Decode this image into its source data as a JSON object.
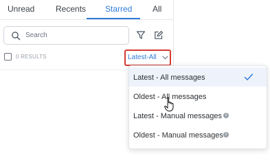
{
  "tabs": [
    {
      "label": "Unread"
    },
    {
      "label": "Recents"
    },
    {
      "label": "Starred"
    },
    {
      "label": "All"
    }
  ],
  "active_tab": "Starred",
  "search": {
    "placeholder": "Search"
  },
  "results": {
    "label": "0 RESULTS",
    "checked": false
  },
  "sort_select": {
    "value": "Latest-All"
  },
  "sort_menu": {
    "items": [
      {
        "label": "Latest - All messages",
        "selected": true
      },
      {
        "label": "Oldest - All messages",
        "selected": false
      },
      {
        "label": "Latest - Manual messages",
        "info": true
      },
      {
        "label": "Oldest - Manual messages",
        "info": true
      }
    ]
  },
  "colors": {
    "accent": "#2f7bd8",
    "highlight": "#d33a32"
  },
  "icons": [
    "search-icon",
    "filter-icon",
    "compose-icon",
    "chevron-down-icon",
    "checkmark-icon",
    "info-icon",
    "hand-cursor-icon"
  ]
}
